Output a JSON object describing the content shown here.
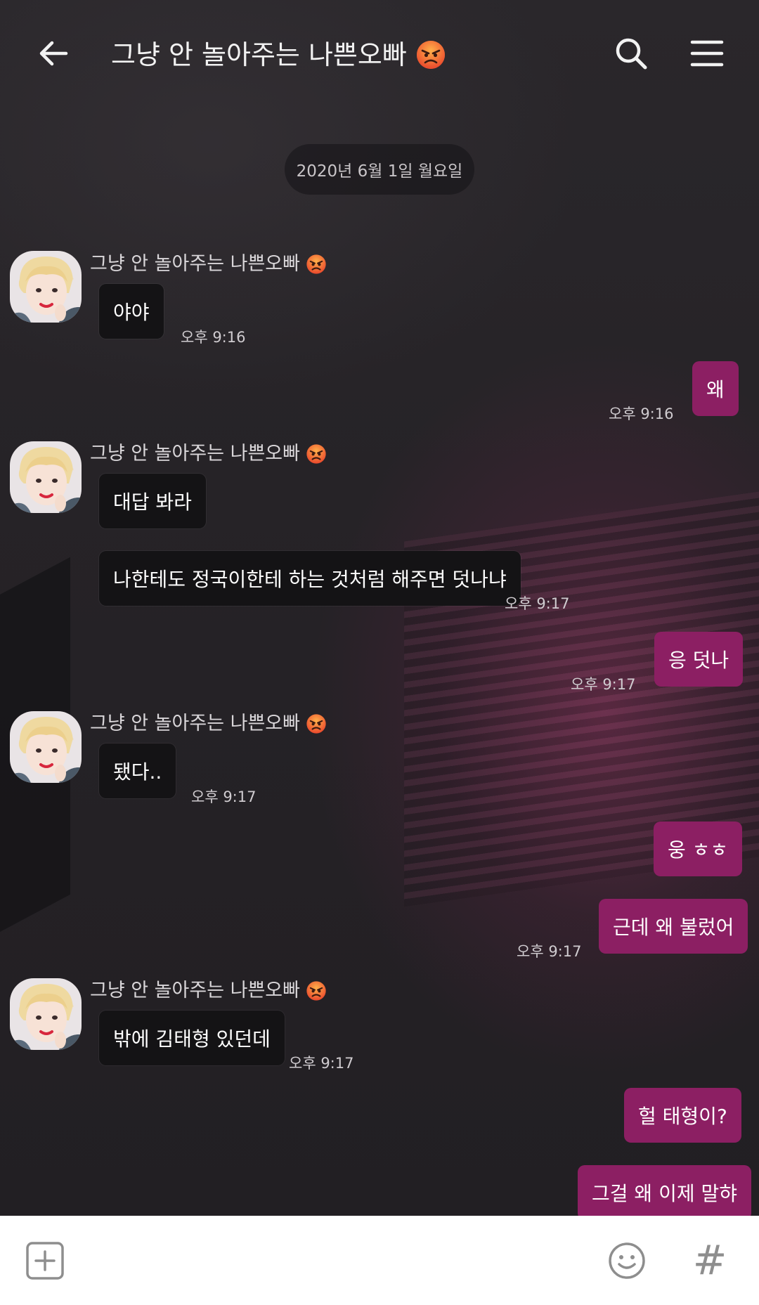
{
  "header": {
    "title": "그냥 안 놀아주는 나쁜오빠",
    "title_emoji": "angry-face-icon",
    "back_icon": "arrow-left-icon",
    "search_icon": "search-icon",
    "menu_icon": "menu-icon"
  },
  "date_divider": "2020년 6월 1일 월요일",
  "contact_name": "그냥 안 놀아주는 나쁜오빠",
  "colors": {
    "outgoing_bubble": "#8c1f63",
    "incoming_bubble": "#141315",
    "background": "#232025"
  },
  "messages": [
    {
      "from": "them",
      "text": "야야",
      "time": "오후 9:16"
    },
    {
      "from": "me",
      "text": "왜",
      "time": "오후 9:16"
    },
    {
      "from": "them",
      "text": "대답 봐라",
      "time": ""
    },
    {
      "from": "them",
      "text": "나한테도 정국이한테 하는 것처럼 해주면 덧나냐",
      "time": "오후 9:17"
    },
    {
      "from": "me",
      "text": "응 덧나",
      "time": "오후 9:17"
    },
    {
      "from": "them",
      "text": "됐다..",
      "time": "오후 9:17"
    },
    {
      "from": "me",
      "text": "웅 ㅎㅎ",
      "time": ""
    },
    {
      "from": "me",
      "text": "근데 왜 불렀어",
      "time": "오후 9:17"
    },
    {
      "from": "them",
      "text": "밖에 김태형 있던데",
      "time": "오후 9:17"
    },
    {
      "from": "me",
      "text": "헐 태형이?",
      "time": ""
    },
    {
      "from": "me",
      "text": "그걸 왜 이제 말햐",
      "time": ""
    }
  ],
  "footer": {
    "add_icon": "plus-square-icon",
    "emoji_icon": "smiley-icon",
    "hashtag": "#"
  }
}
